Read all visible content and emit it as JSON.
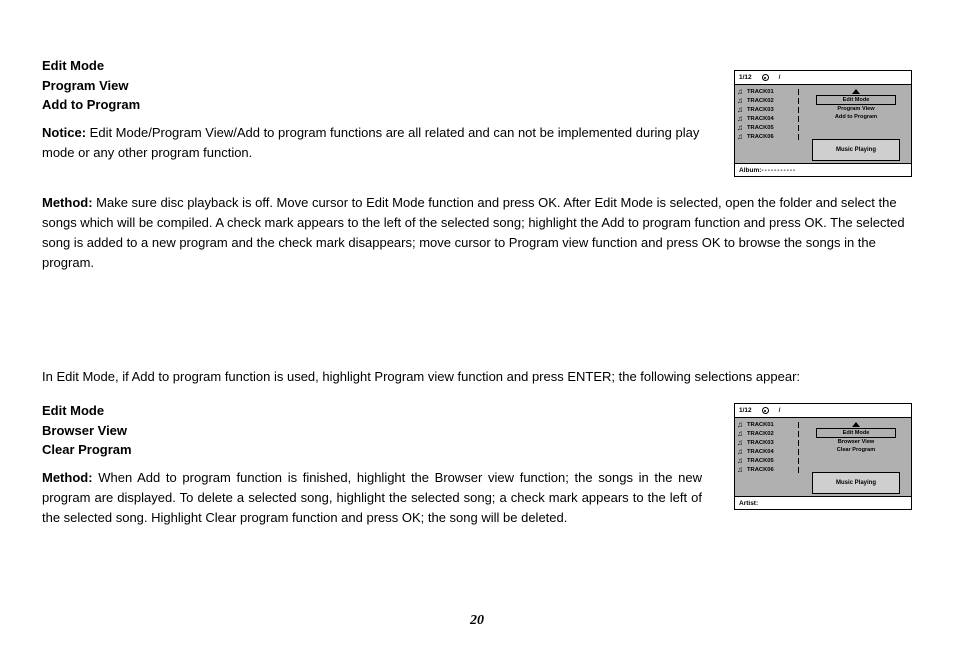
{
  "section1": {
    "heading_line1": "Edit Mode",
    "heading_line2": "Program View",
    "heading_line3": "Add to Program",
    "notice_label": "Notice:",
    "notice_text": " Edit Mode/Program View/Add to program functions are all related and can not be implemented during play mode or any other program function.",
    "method_label": "Method:",
    "method_text": " Make sure disc playback is off. Move cursor to Edit Mode function and press OK. After Edit Mode is selected, open the folder and select the songs which will be compiled. A check mark appears to the left of the selected song; highlight the  Add to program function and press OK. The selected song is added to a new program and the check mark disappears; move cursor to Program view  function and press OK to browse the songs in the program."
  },
  "transition": "In Edit Mode, if Add to program function is used, highlight Program view function and press ENTER; the following selections appear:",
  "section2": {
    "heading_line1": "Edit Mode",
    "heading_line2": "Browser View",
    "heading_line3": "Clear Program",
    "method_label": "Method:",
    "method_text": " When Add to program function is finished, highlight the Browser view function; the songs in the new program are displayed. To delete a selected song, highlight the selected song; a check mark appears to the left of the selected song. Highlight  Clear program function and press OK; the song will be deleted."
  },
  "device1": {
    "counter": "1/12",
    "slash": "/",
    "tracks": [
      "TRACK01",
      "TRACK02",
      "TRACK03",
      "TRACK04",
      "TRACK05",
      "TRACK06"
    ],
    "menu": {
      "boxed": "Edit  Mode",
      "line2": "Program View",
      "line3": "Add to Program"
    },
    "status": "Music Playing",
    "footer_label": "Album:",
    "footer_value": "-----------"
  },
  "device2": {
    "counter": "1/12",
    "slash": "/",
    "tracks": [
      "TRACK01",
      "TRACK02",
      "TRACK03",
      "TRACK04",
      "TRACK05",
      "TRACK06"
    ],
    "menu": {
      "boxed": "Edit  Mode",
      "line2": "Browser View",
      "line3": "Clear Program"
    },
    "status": "Music Playing",
    "footer_label": "Artist:",
    "footer_value": ""
  },
  "page_number": "20"
}
